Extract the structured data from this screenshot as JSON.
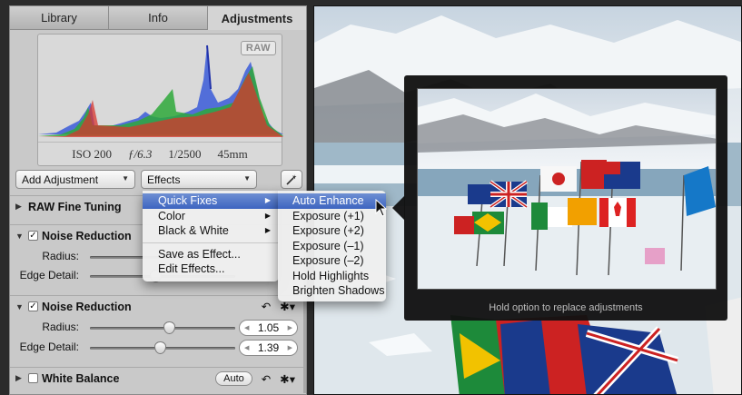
{
  "tabs": [
    {
      "label": "Library"
    },
    {
      "label": "Info"
    },
    {
      "label": "Adjustments",
      "active": true
    }
  ],
  "histogram": {
    "badge": "RAW",
    "iso": "ISO 200",
    "aperture": "ƒ/6.3",
    "shutter": "1/2500",
    "focal": "45mm"
  },
  "toolbar": {
    "add_adjustment": "Add Adjustment",
    "effects": "Effects"
  },
  "sections": {
    "raw_fine_tuning": "RAW Fine Tuning",
    "noise_reduction_1": {
      "title": "Noise Reduction",
      "radius_label": "Radius:",
      "edge_label": "Edge Detail:"
    },
    "noise_reduction_2": {
      "title": "Noise Reduction",
      "radius_label": "Radius:",
      "radius_value": "1.05",
      "radius_level": 0.55,
      "edge_label": "Edge Detail:",
      "edge_value": "1.39",
      "edge_level": 0.48
    },
    "white_balance": {
      "title": "White Balance",
      "auto_label": "Auto"
    }
  },
  "effects_menu": {
    "items": [
      {
        "label": "Quick Fixes",
        "submenu": true,
        "highlighted": true
      },
      {
        "label": "Color",
        "submenu": true
      },
      {
        "label": "Black & White",
        "submenu": true
      },
      {
        "label": "Save as Effect..."
      },
      {
        "label": "Edit Effects..."
      }
    ]
  },
  "quick_fixes_submenu": {
    "items": [
      {
        "label": "Auto Enhance",
        "highlighted": true
      },
      {
        "label": "Exposure (+1)"
      },
      {
        "label": "Exposure (+2)"
      },
      {
        "label": "Exposure (–1)"
      },
      {
        "label": "Exposure (–2)"
      },
      {
        "label": "Hold Highlights"
      },
      {
        "label": "Brighten Shadows"
      }
    ]
  },
  "preview": {
    "caption": "Hold option to replace adjustments"
  },
  "colors": {
    "highlight": "#3d64c0",
    "panel": "#c9c9c9"
  }
}
